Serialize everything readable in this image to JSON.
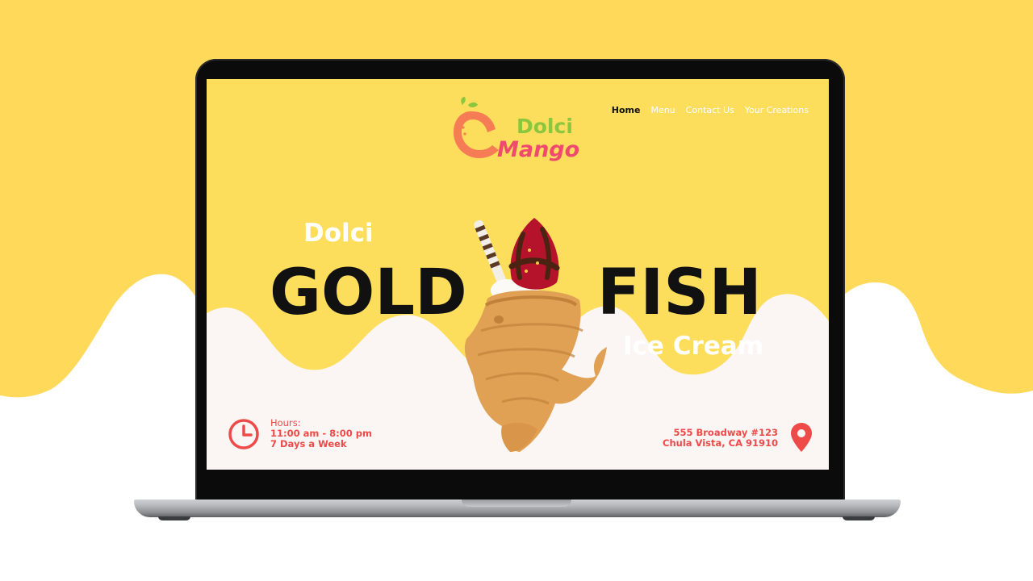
{
  "brand": {
    "logo_word_1": "Dolci",
    "logo_word_2": "Mango"
  },
  "nav": {
    "items": [
      {
        "label": "Home",
        "active": true
      },
      {
        "label": "Menu",
        "active": false
      },
      {
        "label": "Contact Us",
        "active": false
      },
      {
        "label": "Your Creations",
        "active": false
      }
    ]
  },
  "hero": {
    "kicker": "Dolci",
    "title_left": "GOLD",
    "title_right": "FISH",
    "subtitle": "Ice Cream"
  },
  "hours": {
    "label": "Hours:",
    "time": "11:00 am - 8:00 pm",
    "days": "7 Days a Week"
  },
  "address": {
    "line_1": "555 Broadway #123",
    "line_2": "Chula Vista, CA 91910"
  },
  "icons": {
    "clock": "clock-icon",
    "pin": "location-pin-icon",
    "logo_mango": "mango-icon",
    "product": "goldfish-ice-cream-image"
  },
  "colors": {
    "backdrop_yellow": "#ffd95a",
    "screen_yellow": "#fcdd5c",
    "cream": "#fbf6f3",
    "accent_red": "#ee4a4a",
    "logo_green": "#8cc63e",
    "logo_pink": "#ef4a6d",
    "title_black": "#111111"
  }
}
